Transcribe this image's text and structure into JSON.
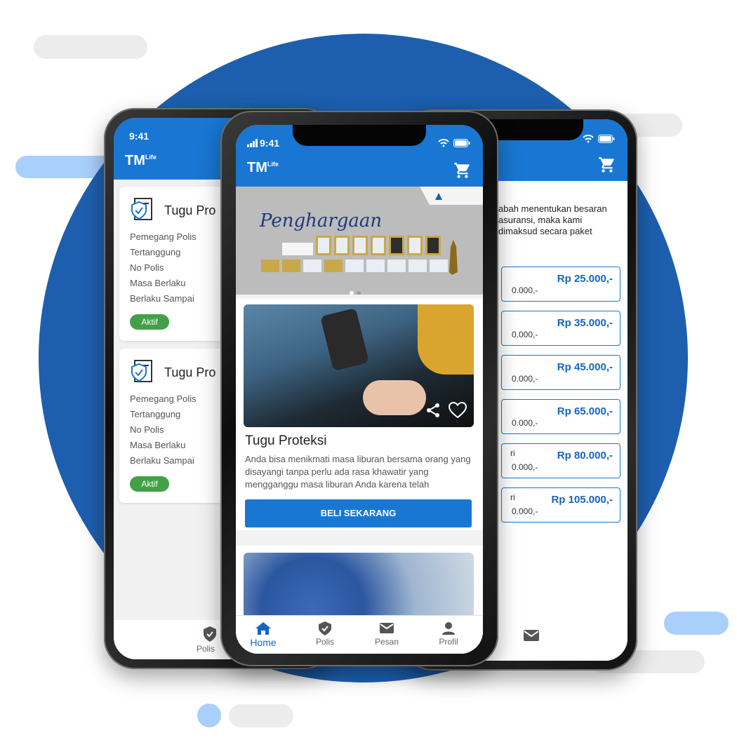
{
  "status": {
    "time": "9:41"
  },
  "app": {
    "logo_main": "TM",
    "logo_sub": "Life"
  },
  "left_phone": {
    "cards": [
      {
        "title": "Tugu Pro",
        "rows": [
          "Pemegang Polis",
          "Tertanggung",
          "No Polis",
          "Masa Berlaku",
          "Berlaku Sampai"
        ],
        "badge": "Aktif"
      },
      {
        "title": "Tugu Pro",
        "rows": [
          "Pemegang Polis",
          "Tertanggung",
          "No Polis",
          "Masa Berlaku",
          "Berlaku Sampai"
        ],
        "badge": "Aktif"
      }
    ],
    "nav_label": "Polis"
  },
  "right_phone": {
    "description": "abah menentukan besaran asuransi, maka kami dimaksud secara paket",
    "prices": [
      {
        "amount": "Rp 25.000,-",
        "sub": "0.000,-",
        "label": ""
      },
      {
        "amount": "Rp 35.000,-",
        "sub": "0.000,-",
        "label": ""
      },
      {
        "amount": "Rp 45.000,-",
        "sub": "0.000,-",
        "label": ""
      },
      {
        "amount": "Rp 65.000,-",
        "sub": "0.000,-",
        "label": ""
      },
      {
        "amount": "Rp 80.000,-",
        "sub": "0.000,-",
        "label": "ri"
      },
      {
        "amount": "Rp 105.000,-",
        "sub": "0.000,-",
        "label": "ri"
      }
    ]
  },
  "center_phone": {
    "banner_title": "Penghargaan",
    "banner_dots": 2,
    "product": {
      "title": "Tugu Proteksi",
      "description": "Anda bisa menikmati masa liburan bersama orang yang disayangi tanpa perlu ada rasa khawatir yang mengganggu masa liburan Anda karena telah",
      "button": "BELI SEKARANG"
    },
    "nav": [
      {
        "label": "Home",
        "icon": "home-icon",
        "active": true
      },
      {
        "label": "Polis",
        "icon": "shield-icon",
        "active": false
      },
      {
        "label": "Pesan",
        "icon": "mail-icon",
        "active": false
      },
      {
        "label": "Profil",
        "icon": "person-icon",
        "active": false
      }
    ]
  },
  "colors": {
    "brand": "#1976d2",
    "circle": "#1d5fae",
    "active_badge": "#43a047",
    "price_text": "#1565c0"
  }
}
